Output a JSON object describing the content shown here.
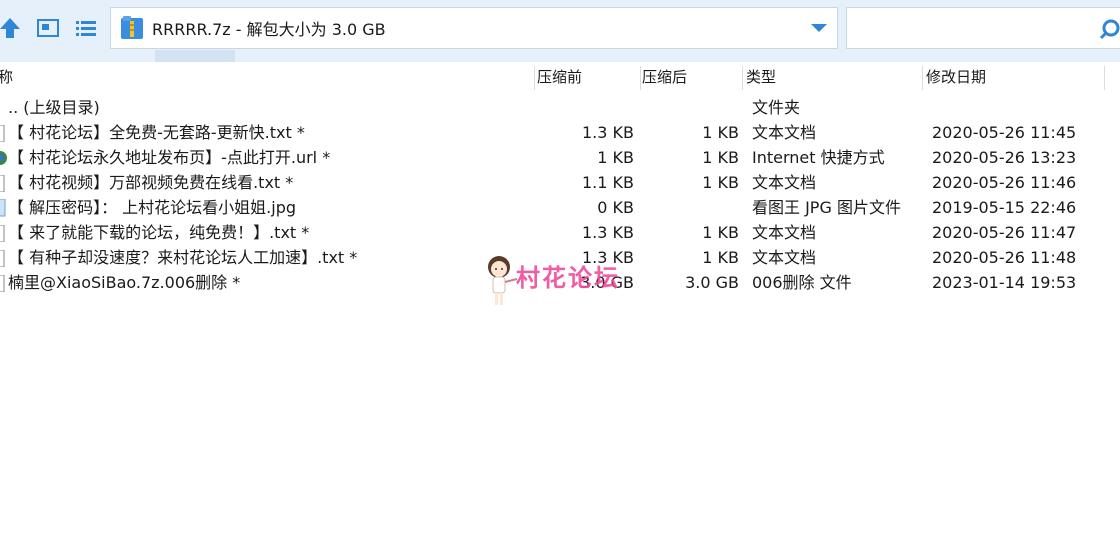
{
  "toolbar": {
    "address_path": "RRRRR.7z - 解包大小为 3.0 GB",
    "search_value": ""
  },
  "header": {
    "col_name": "称",
    "col_compressed": "压缩前",
    "col_size": "压缩后",
    "col_type": "类型",
    "col_modified": "修改日期"
  },
  "rows": [
    {
      "name": ".. (上级目录)",
      "compressed": "",
      "size": "",
      "type": "文件夹",
      "date": ""
    },
    {
      "name": "【 村花论坛】全免费-无套路-更新快.txt *",
      "compressed": "1.3 KB",
      "size": "1 KB",
      "type": "文本文档",
      "date": "2020-05-26 11:45"
    },
    {
      "name": "【 村花论坛永久地址发布页】-点此打开.url *",
      "compressed": "1 KB",
      "size": "1 KB",
      "type": "Internet 快捷方式",
      "date": "2020-05-26 13:23"
    },
    {
      "name": "【 村花视频】万部视频免费在线看.txt *",
      "compressed": "1.1 KB",
      "size": "1 KB",
      "type": "文本文档",
      "date": "2020-05-26 11:46"
    },
    {
      "name": "【 解压密码】： 上村花论坛看小姐姐.jpg",
      "compressed": "0 KB",
      "size": "",
      "type": "看图王 JPG 图片文件",
      "date": "2019-05-15 22:46"
    },
    {
      "name": "【 来了就能下载的论坛，纯免费！】.txt *",
      "compressed": "1.3 KB",
      "size": "1 KB",
      "type": "文本文档",
      "date": "2020-05-26 11:47"
    },
    {
      "name": "【 有种子却没速度？来村花论坛人工加速】.txt *",
      "compressed": "1.3 KB",
      "size": "1 KB",
      "type": "文本文档",
      "date": "2020-05-26 11:48"
    },
    {
      "name": "楠里@XiaoSiBao.7z.006删除 *",
      "compressed": "3.0 GB",
      "size": "3.0 GB",
      "type": "006删除 文件",
      "date": "2023-01-14 19:53"
    }
  ],
  "watermark": {
    "text": "村花论坛"
  },
  "colors": {
    "accent": "#2f86d6",
    "toolbar_bg": "#e6f0fb",
    "watermark": "#f04c9c"
  }
}
